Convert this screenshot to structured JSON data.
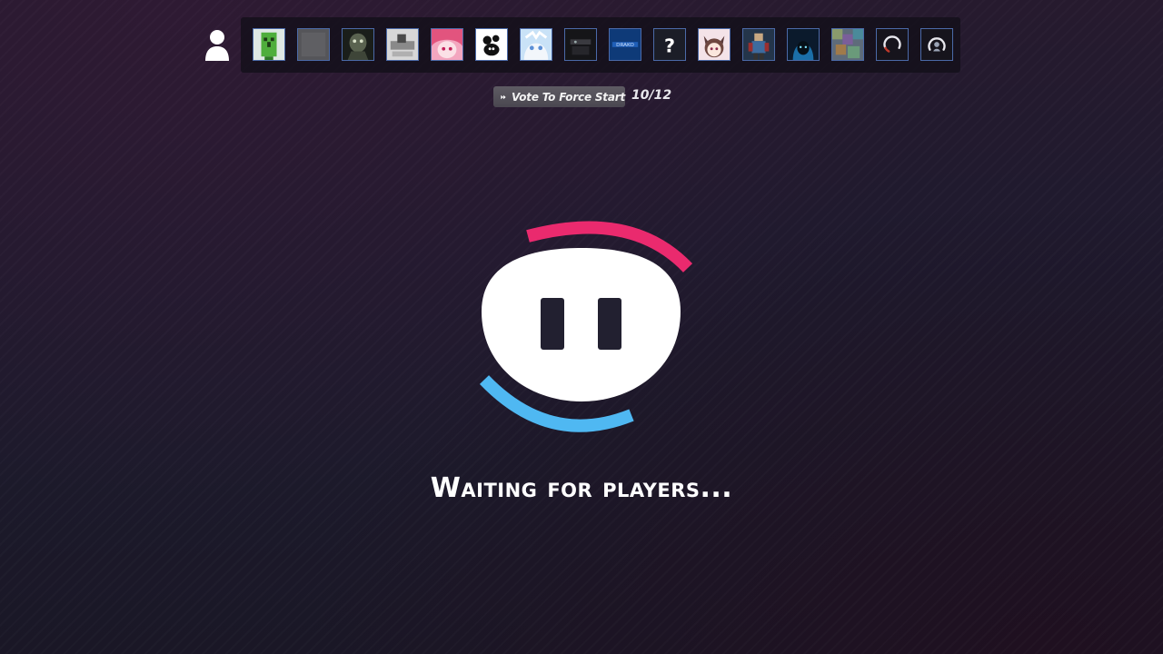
{
  "lobby": {
    "vote_button_label": "Vote To Force Start",
    "vote_count": "10/12",
    "status_text": "Waiting for players..."
  },
  "icons": {
    "user": "user-icon",
    "vote": "fast-forward-icon",
    "logo": "paused-face-logo-icon"
  },
  "players": [
    {
      "slot": 1,
      "avatar": "green-creeper-avatar"
    },
    {
      "slot": 2,
      "avatar": "grey-blank-avatar"
    },
    {
      "slot": 3,
      "avatar": "dark-creature-avatar"
    },
    {
      "slot": 4,
      "avatar": "grey-photo-avatar"
    },
    {
      "slot": 5,
      "avatar": "pink-anime-avatar"
    },
    {
      "slot": 6,
      "avatar": "black-white-cartoon-avatar"
    },
    {
      "slot": 7,
      "avatar": "white-hair-anime-avatar"
    },
    {
      "slot": 8,
      "avatar": "dark-masked-avatar"
    },
    {
      "slot": 9,
      "avatar": "blue-logo-avatar"
    },
    {
      "slot": 10,
      "avatar": "unknown-question-avatar",
      "text": "?"
    },
    {
      "slot": 11,
      "avatar": "cat-ear-anime-avatar"
    },
    {
      "slot": 12,
      "avatar": "robot-figure-avatar"
    },
    {
      "slot": 13,
      "avatar": "blue-hooded-avatar"
    },
    {
      "slot": 14,
      "avatar": "colorful-noise-avatar"
    },
    {
      "slot": 15,
      "avatar": "loading-spinner-avatar"
    },
    {
      "slot": 16,
      "avatar": "loading-spinner-avatar"
    }
  ],
  "colors": {
    "background": "#1f1a2e",
    "logo_pink": "#ea2a6e",
    "logo_blue": "#4fb8f2",
    "logo_face": "#ffffff",
    "avatar_border": "#4b6aa8"
  }
}
